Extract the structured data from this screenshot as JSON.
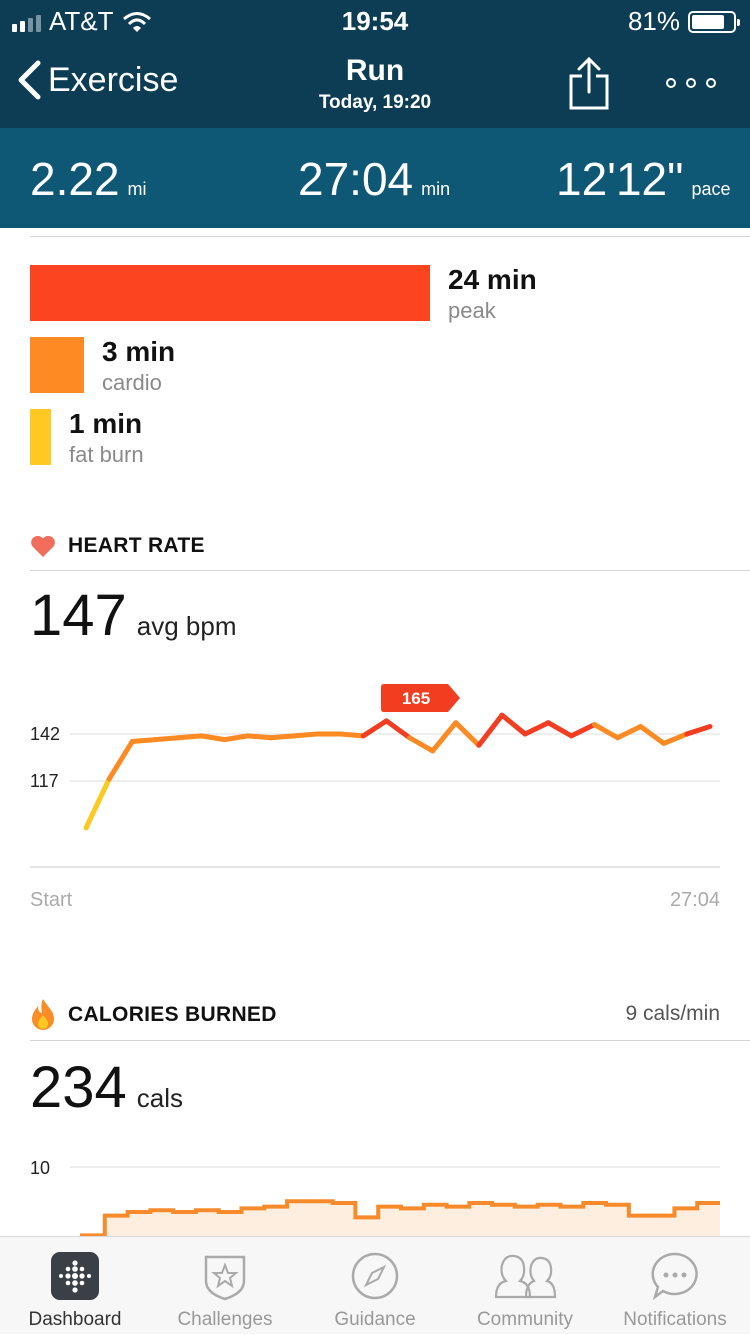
{
  "status": {
    "carrier": "AT&T",
    "time": "19:54",
    "battery": "81%",
    "battery_level": 0.81
  },
  "nav": {
    "back_label": "Exercise",
    "title": "Run",
    "subtitle": "Today, 19:20"
  },
  "stats": [
    {
      "value": "2.22",
      "unit": "mi"
    },
    {
      "value": "27:04",
      "unit": "min"
    },
    {
      "value": "12'12\"",
      "unit": "pace"
    }
  ],
  "zones": [
    {
      "minutes": "24 min",
      "name": "peak",
      "color": "#fc4520"
    },
    {
      "minutes": "3 min",
      "name": "cardio",
      "color": "#fd8a22"
    },
    {
      "minutes": "1 min",
      "name": "fat burn",
      "color": "#fdc922"
    }
  ],
  "heart_rate": {
    "heading": "HEART RATE",
    "avg_value": "147",
    "avg_unit": "avg bpm",
    "y_tick_high": "142",
    "y_tick_low": "117",
    "peak_label": "165",
    "start_label": "Start",
    "end_label": "27:04"
  },
  "calories": {
    "heading": "CALORIES BURNED",
    "rate": "9 cals/min",
    "total_value": "234",
    "total_unit": "cals",
    "y_tick": "10"
  },
  "chart_data": [
    {
      "type": "line",
      "title": "HEART RATE",
      "xlabel": "",
      "ylabel": "",
      "x_labels": [
        "Start",
        "27:04"
      ],
      "y_ticks": [
        142,
        117
      ],
      "x": [
        0,
        1,
        2,
        3,
        4,
        5,
        6,
        7,
        8,
        9,
        10,
        11,
        12,
        13,
        14,
        15,
        16,
        17,
        18,
        19,
        20,
        21,
        22,
        23,
        24,
        25,
        26,
        27
      ],
      "values": [
        92,
        118,
        138,
        139,
        140,
        141,
        139,
        141,
        140,
        141,
        142,
        142,
        141,
        149,
        140,
        133,
        148,
        136,
        152,
        142,
        148,
        141,
        147,
        140,
        146,
        137,
        142,
        146
      ],
      "peak_annotation": 165,
      "colors": {
        "low": "#fdc922",
        "mid": "#fd8a22",
        "high": "#f23d20"
      }
    },
    {
      "type": "area",
      "title": "CALORIES BURNED",
      "xlabel": "",
      "ylabel": "",
      "y_ticks": [
        10
      ],
      "x": [
        0,
        1,
        2,
        3,
        4,
        5,
        6,
        7,
        8,
        9,
        10,
        11,
        12,
        13,
        14,
        15,
        16,
        17,
        18,
        19,
        20,
        21,
        22,
        23,
        24,
        25,
        26,
        27
      ],
      "values": [
        6.2,
        7.3,
        7.5,
        7.6,
        7.5,
        7.6,
        7.5,
        7.7,
        7.8,
        8.1,
        8.1,
        8.0,
        7.2,
        7.8,
        7.7,
        7.9,
        7.8,
        8.0,
        7.9,
        7.8,
        7.9,
        7.8,
        8.0,
        7.9,
        7.3,
        7.3,
        7.7,
        8.0
      ],
      "colors": {
        "line": "#f78a2a",
        "fill": "#fdeee0"
      }
    }
  ],
  "tabs": [
    {
      "label": "Dashboard",
      "icon": "dashboard-icon",
      "active": true
    },
    {
      "label": "Challenges",
      "icon": "star-badge-icon",
      "active": false
    },
    {
      "label": "Guidance",
      "icon": "compass-icon",
      "active": false
    },
    {
      "label": "Community",
      "icon": "people-icon",
      "active": false
    },
    {
      "label": "Notifications",
      "icon": "chat-bubble-icon",
      "active": false
    }
  ]
}
